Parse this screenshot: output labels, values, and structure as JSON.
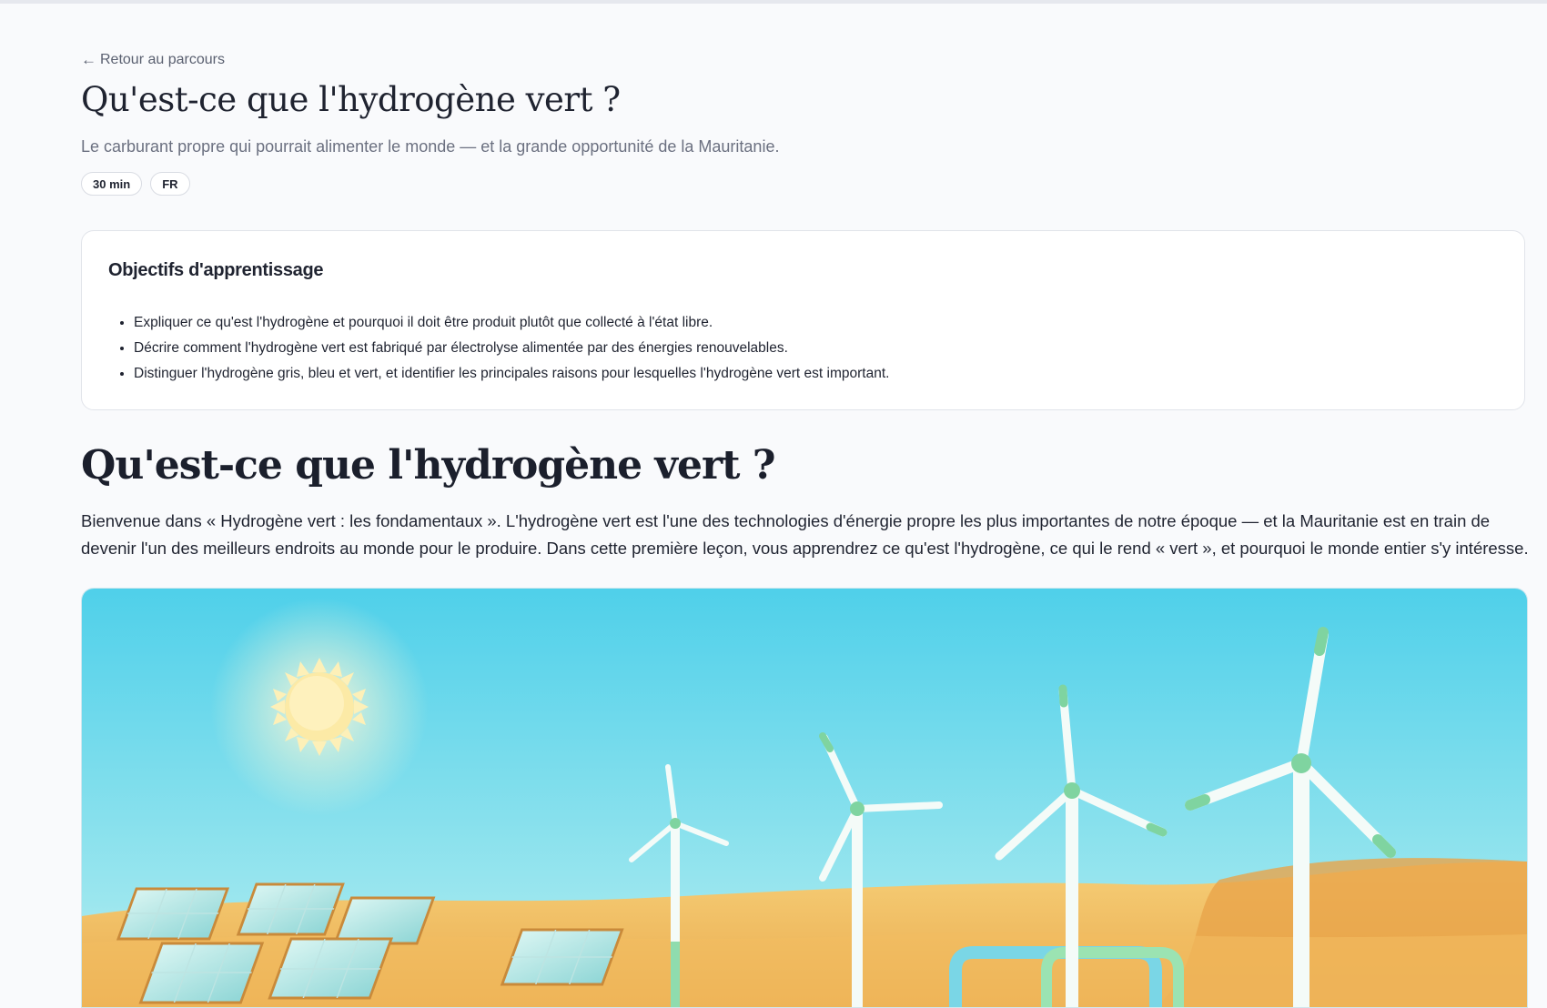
{
  "nav": {
    "back_arrow": "←",
    "back_label": "Retour au parcours"
  },
  "lesson": {
    "title": "Qu'est-ce que l'hydrogène vert ?",
    "subtitle": "Le carburant propre qui pourrait alimenter le monde — et la grande opportunité de la Mauritanie.",
    "tags": [
      "30 min",
      "FR"
    ]
  },
  "objectives": {
    "title": "Objectifs d'apprentissage",
    "items": [
      "Expliquer ce qu'est l'hydrogène et pourquoi il doit être produit plutôt que collecté à l'état libre.",
      "Décrire comment l'hydrogène vert est fabriqué par électrolyse alimentée par des énergies renouvelables.",
      "Distinguer l'hydrogène gris, bleu et vert, et identifier les principales raisons pour lesquelles l'hydrogène vert est important."
    ]
  },
  "content": {
    "heading": "Qu'est-ce que l'hydrogène vert ?",
    "intro": "Bienvenue dans « Hydrogène vert : les fondamentaux ». L'hydrogène vert est l'une des technologies d'énergie propre les plus importantes de notre époque — et la Mauritanie est en train de devenir l'un des meilleurs endroits au monde pour le produire. Dans cette première leçon, vous apprendrez ce qu'est l'hydrogène, ce qui le rend « vert », et pourquoi le monde entier s'y intéresse."
  },
  "colors": {
    "sky_top": "#4fd0ea",
    "sky_bottom": "#c9f1ef",
    "sun": "#fbeeb0",
    "sand": "#f3c56a",
    "turbine": "#f4fbf8",
    "turbine_accent": "#7fd4a0"
  }
}
